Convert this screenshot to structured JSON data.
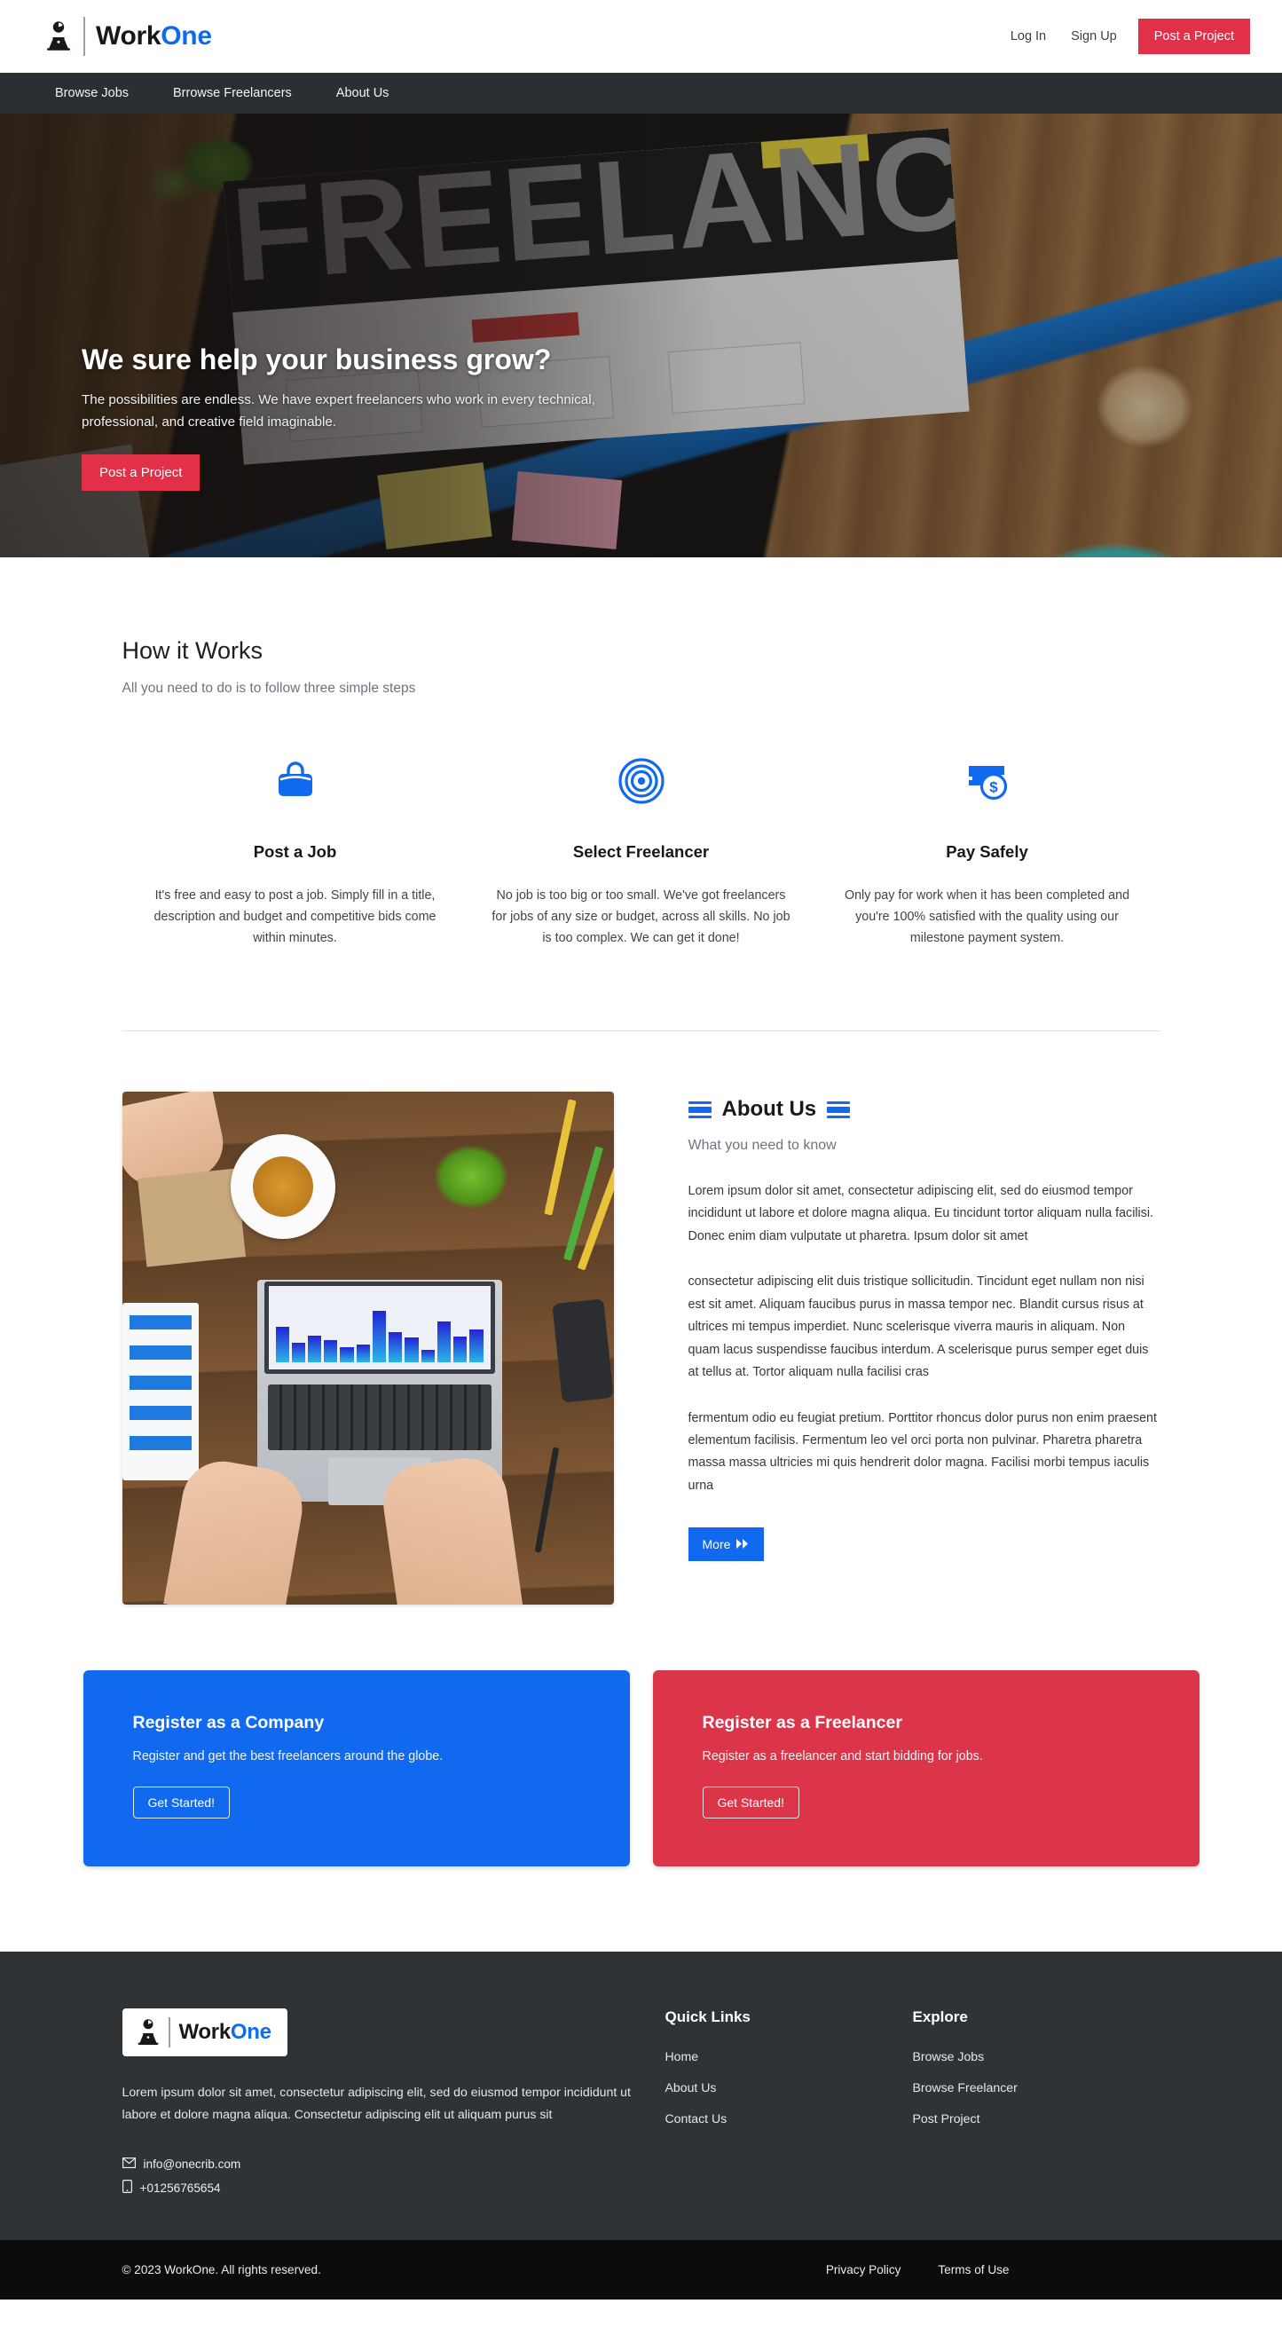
{
  "brand": {
    "name_part1": "Work",
    "name_part2": "One",
    "logo_icon": "person-at-laptop-icon"
  },
  "topbar": {
    "login": "Log In",
    "signup": "Sign Up",
    "post_project": "Post a Project",
    "post_project_color": "#e23048"
  },
  "nav": {
    "items": [
      {
        "label": "Browse Jobs"
      },
      {
        "label": "Brrowse Freelancers"
      },
      {
        "label": "About Us"
      }
    ]
  },
  "hero": {
    "title": "We sure help your business grow?",
    "subtitle": "The possibilities are endless. We have expert freelancers who work in every technical, professional, and creative field imaginable.",
    "cta": "Post a Project",
    "background_word": "FREELANCE"
  },
  "how_it_works": {
    "title": "How it Works",
    "subtitle": "All you need to do is to follow three simple steps",
    "accent_color": "#1169f0",
    "steps": [
      {
        "icon": "briefcase-icon",
        "title": "Post a Job",
        "desc": "It's free and easy to post a job. Simply fill in a title, description and budget and competitive bids come within minutes."
      },
      {
        "icon": "target-icon",
        "title": "Select Freelancer",
        "desc": "No job is too big or too small. We've got freelancers for jobs of any size or budget, across all skills. No job is too complex. We can get it done!"
      },
      {
        "icon": "money-dollar-icon",
        "title": "Pay Safely",
        "desc": "Only pay for work when it has been completed and you're 100% satisfied with the quality using our milestone payment system."
      }
    ]
  },
  "about": {
    "heading": "About Us",
    "subheading": "What you need to know",
    "paragraph1": "Lorem ipsum dolor sit amet, consectetur adipiscing elit, sed do eiusmod tempor incididunt ut labore et dolore magna aliqua. Eu tincidunt tortor aliquam nulla facilisi. Donec enim diam vulputate ut pharetra. Ipsum dolor sit amet",
    "paragraph2": "consectetur adipiscing elit duis tristique sollicitudin. Tincidunt eget nullam non nisi est sit amet. Aliquam faucibus purus in massa tempor nec. Blandit cursus risus at ultrices mi tempus imperdiet. Nunc scelerisque viverra mauris in aliquam. Non quam lacus suspendisse faucibus interdum. A scelerisque purus semper eget duis at tellus at. Tortor aliquam nulla facilisi cras",
    "paragraph3": "fermentum odio eu feugiat pretium. Porttitor rhoncus dolor purus non enim praesent elementum facilisis. Fermentum leo vel orci porta non pulvinar. Pharetra pharetra massa massa ultricies mi quis hendrerit dolor magna. Facilisi morbi tempus iaculis urna",
    "more_button": "More",
    "more_icon": "double-chevron-right-icon",
    "image_alt": "desk-with-laptop-photo"
  },
  "cta_cards": [
    {
      "title": "Register as a Company",
      "desc": "Register and get the best freelancers around the globe.",
      "button": "Get Started!",
      "color": "#1169f0"
    },
    {
      "title": "Register as a Freelancer",
      "desc": "Register as a freelancer and start bidding for jobs.",
      "button": "Get Started!",
      "color": "#dc3448"
    }
  ],
  "footer": {
    "about": "Lorem ipsum dolor sit amet, consectetur adipiscing elit, sed do eiusmod tempor incididunt ut labore et dolore magna aliqua. Consectetur adipiscing elit ut aliquam purus sit",
    "email": "info@onecrib.com",
    "email_icon": "envelope-icon",
    "phone": "+01256765654",
    "phone_icon": "mobile-phone-icon",
    "quick_links": {
      "title": "Quick Links",
      "items": [
        {
          "label": "Home"
        },
        {
          "label": "About Us"
        },
        {
          "label": "Contact Us"
        }
      ]
    },
    "explore": {
      "title": "Explore",
      "items": [
        {
          "label": "Browse Jobs"
        },
        {
          "label": "Browse Freelancer"
        },
        {
          "label": "Post Project"
        }
      ]
    },
    "copyright": "© 2023 WorkOne. All rights reserved.",
    "bottom_links": [
      {
        "label": "Privacy Policy"
      },
      {
        "label": "Terms of Use"
      }
    ]
  }
}
